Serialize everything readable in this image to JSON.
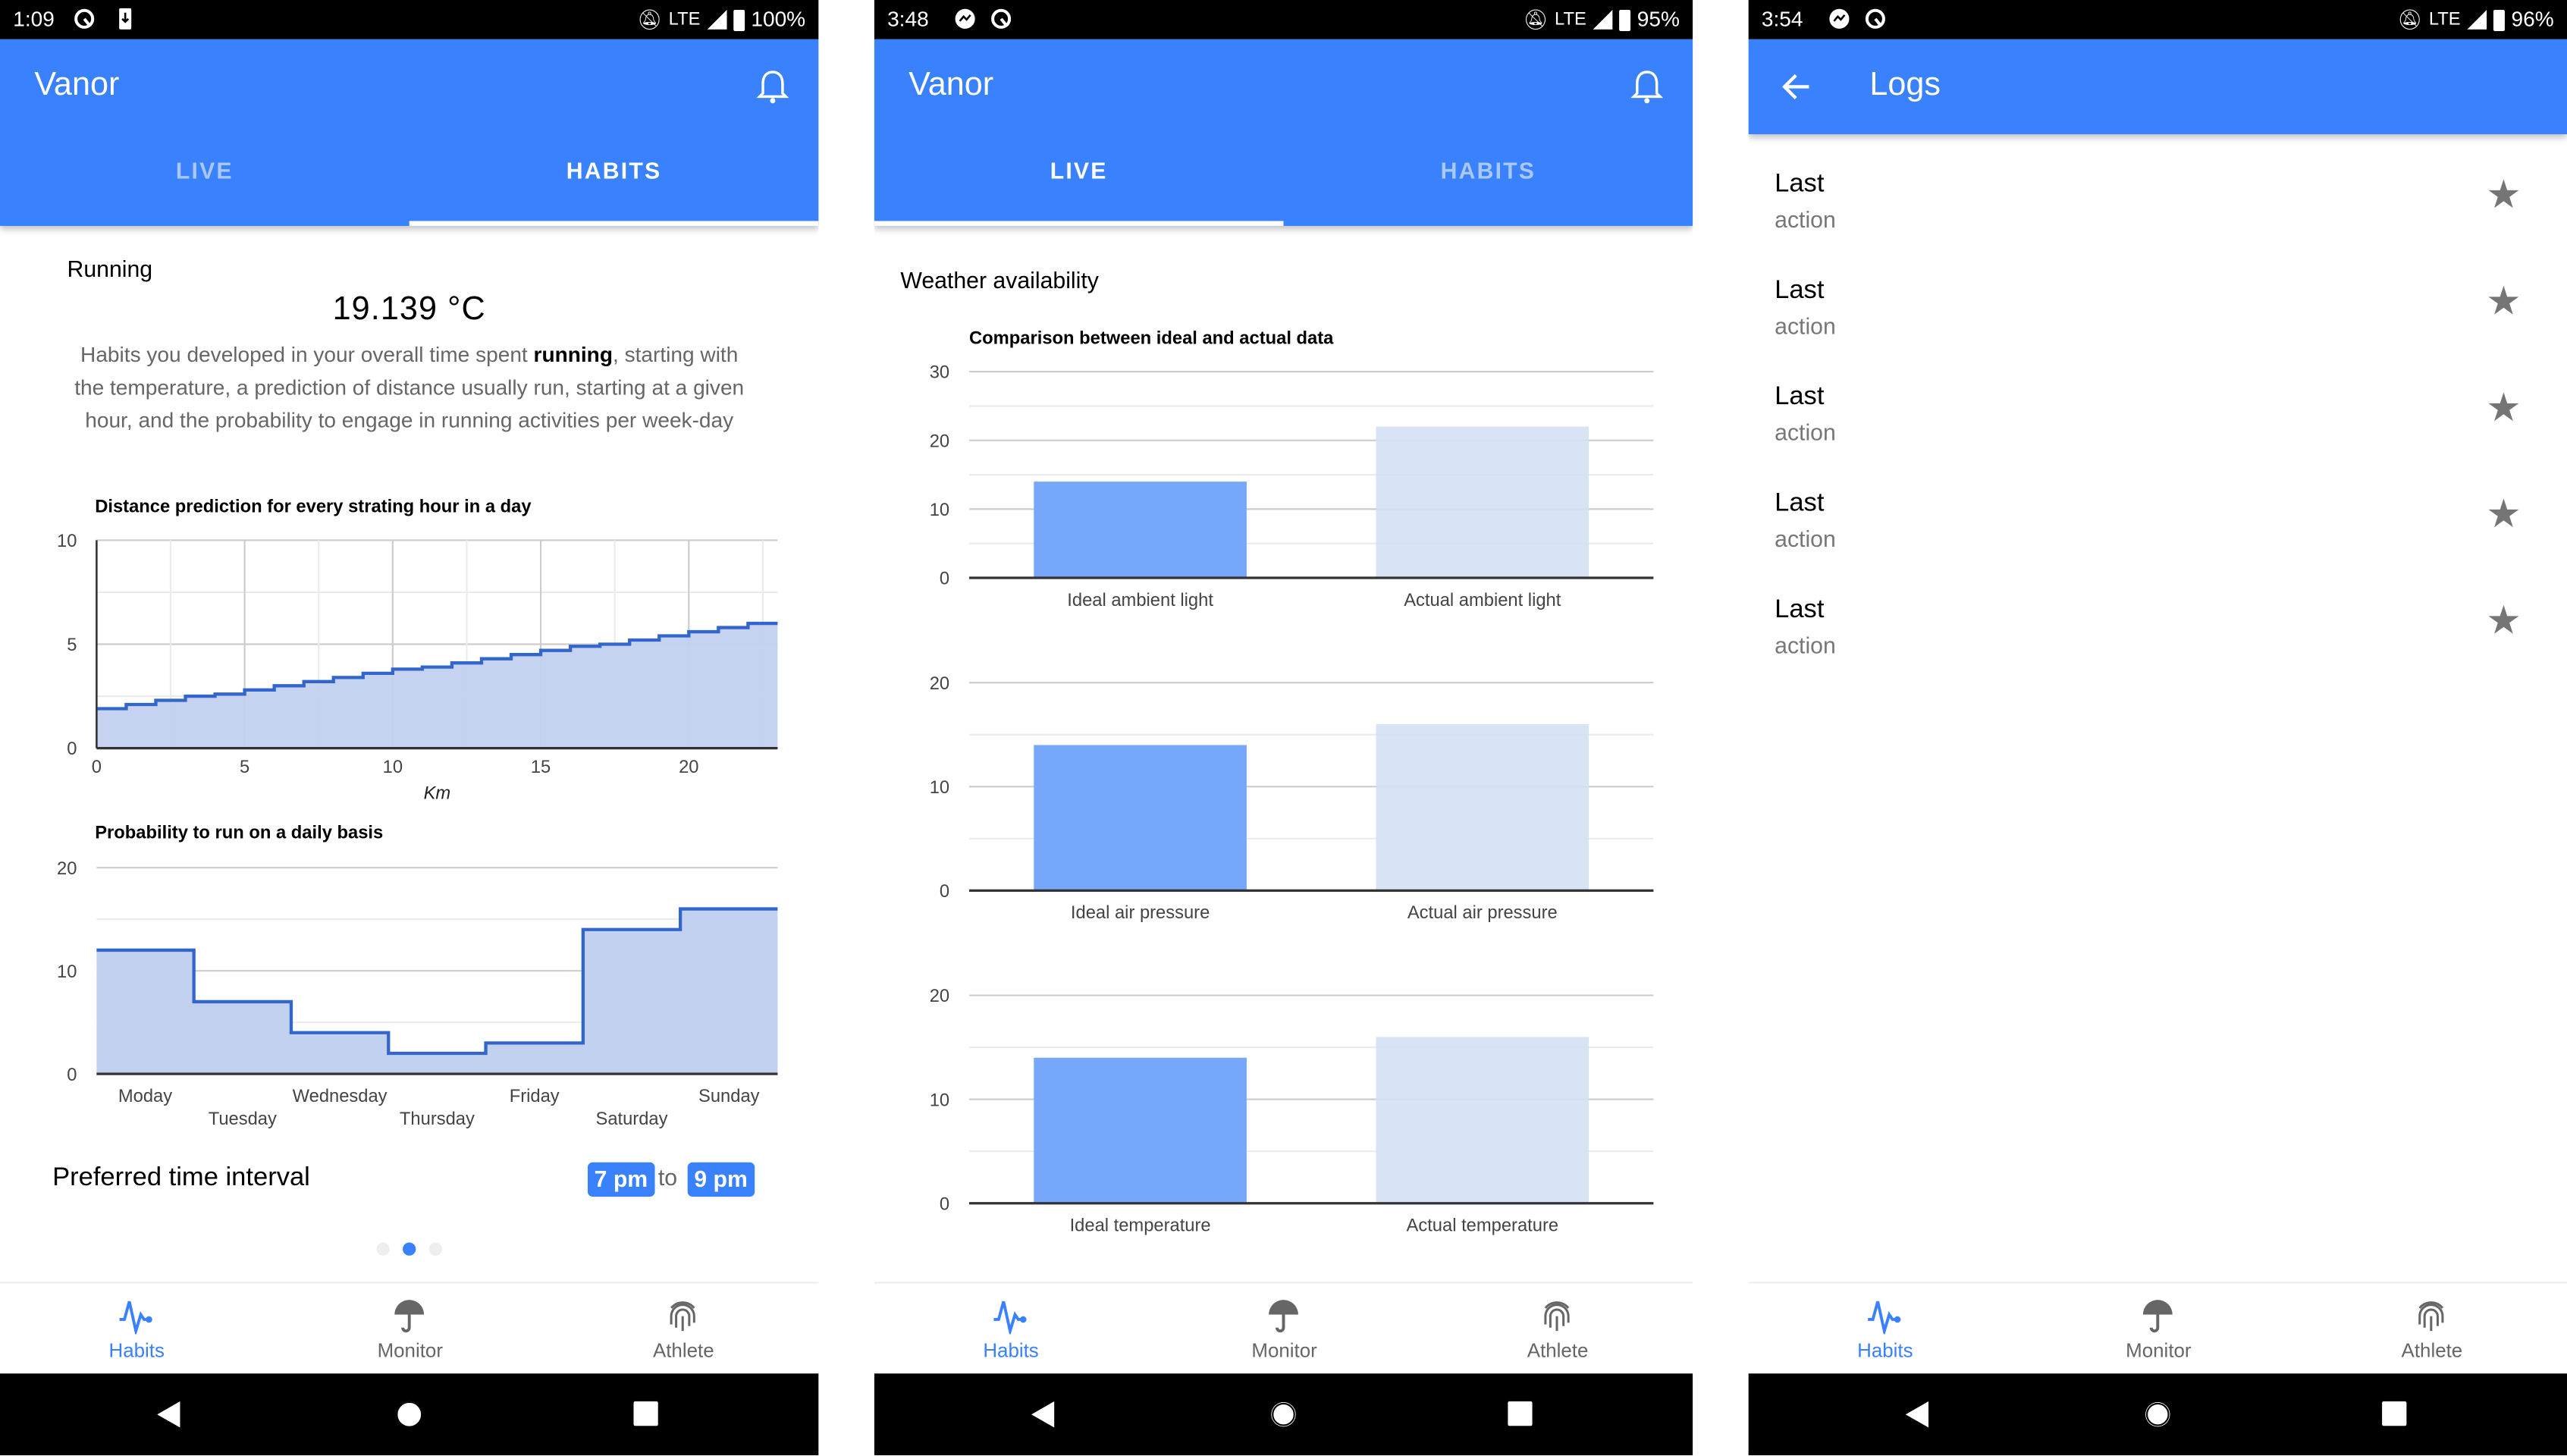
{
  "colors": {
    "primary": "#3A81FE",
    "line": "#3366CC",
    "area": "#C2D1F0",
    "ideal_bar": "#76A7FA",
    "actual_bar": "#D4E0F5"
  },
  "panels": [
    {
      "status": {
        "time": "1:09",
        "battery": "100%",
        "network": "LTE"
      },
      "app_bar": {
        "title": "Vanor"
      },
      "tabs": [
        {
          "label": "LIVE",
          "active": false
        },
        {
          "label": "HABITS",
          "active": true
        }
      ],
      "heading": "Running",
      "temperature": "19.139 °C",
      "description": {
        "before": "Habits you developed in your overall time spent ",
        "bold": "running",
        "after": ", starting with the temperature, a prediction of distance usually run, starting at a given hour, and the probability to engage in running activities per week-day"
      },
      "preferred": {
        "label": "Preferred time interval",
        "from": "7 pm",
        "to_word": "to",
        "to": "9 pm"
      },
      "pager": {
        "pages": 3,
        "active": 1
      }
    },
    {
      "status": {
        "time": "3:48",
        "battery": "95%",
        "network": "LTE"
      },
      "app_bar": {
        "title": "Vanor"
      },
      "tabs": [
        {
          "label": "LIVE",
          "active": true
        },
        {
          "label": "HABITS",
          "active": false
        }
      ],
      "heading": "Weather availability"
    },
    {
      "status": {
        "time": "3:54",
        "battery": "96%",
        "network": "LTE"
      },
      "app_bar": {
        "title": "Logs"
      },
      "logs": [
        {
          "title": "Last",
          "subtitle": "action",
          "icon": "star-icon"
        },
        {
          "title": "Last",
          "subtitle": "action",
          "icon": "star-icon"
        },
        {
          "title": "Last",
          "subtitle": "action",
          "icon": "star-icon"
        },
        {
          "title": "Last",
          "subtitle": "action",
          "icon": "star-icon"
        },
        {
          "title": "Last",
          "subtitle": "action",
          "icon": "star-icon"
        }
      ]
    }
  ],
  "bottom_nav": [
    {
      "label": "Habits",
      "icon": "heartbeat-icon",
      "active": true
    },
    {
      "label": "Monitor",
      "icon": "umbrella-icon",
      "active": false
    },
    {
      "label": "Athlete",
      "icon": "fingerprint-icon",
      "active": false
    }
  ],
  "chart_data": [
    {
      "type": "area",
      "step": true,
      "title": "Distance prediction for every strating hour in a day",
      "xlabel": "Km",
      "ylabel": "",
      "x": [
        0,
        1,
        2,
        3,
        4,
        5,
        6,
        7,
        8,
        9,
        10,
        11,
        12,
        13,
        14,
        15,
        16,
        17,
        18,
        19,
        20,
        21,
        22
      ],
      "values": [
        1.9,
        2.1,
        2.3,
        2.5,
        2.6,
        2.8,
        3.0,
        3.2,
        3.4,
        3.6,
        3.8,
        3.9,
        4.1,
        4.3,
        4.5,
        4.7,
        4.9,
        5.0,
        5.2,
        5.4,
        5.6,
        5.8,
        6.0
      ],
      "xlim": [
        0,
        23
      ],
      "ylim": [
        0,
        10
      ],
      "xticks": [
        0,
        5,
        10,
        15,
        20
      ],
      "yticks": [
        0,
        5,
        10
      ],
      "grid": true,
      "legend": "none"
    },
    {
      "type": "area",
      "step": true,
      "title": "Probability to run on a daily basis",
      "xlabel": "",
      "ylabel": "",
      "categories": [
        "Moday",
        "Tuesday",
        "Wednesday",
        "Thursday",
        "Friday",
        "Saturday",
        "Sunday"
      ],
      "values": [
        12,
        7,
        4,
        2,
        3,
        14,
        16
      ],
      "ylim": [
        0,
        20
      ],
      "yticks": [
        0,
        10,
        20
      ],
      "grid": true,
      "legend": "none"
    },
    {
      "type": "bar",
      "title": "Comparison between ideal and actual data",
      "categories": [
        "Ideal ambient light",
        "Actual ambient light"
      ],
      "values": [
        14,
        22
      ],
      "ylim": [
        0,
        30
      ],
      "yticks": [
        0,
        10,
        20,
        30
      ],
      "grid": true,
      "legend": "none"
    },
    {
      "type": "bar",
      "title": "",
      "categories": [
        "Ideal air pressure",
        "Actual air pressure"
      ],
      "values": [
        14,
        16
      ],
      "ylim": [
        0,
        20
      ],
      "yticks": [
        0,
        10,
        20
      ],
      "grid": true,
      "legend": "none"
    },
    {
      "type": "bar",
      "title": "",
      "categories": [
        "Ideal temperature",
        "Actual temperature"
      ],
      "values": [
        14,
        16
      ],
      "ylim": [
        0,
        20
      ],
      "yticks": [
        0,
        10,
        20
      ],
      "grid": true,
      "legend": "none"
    }
  ]
}
